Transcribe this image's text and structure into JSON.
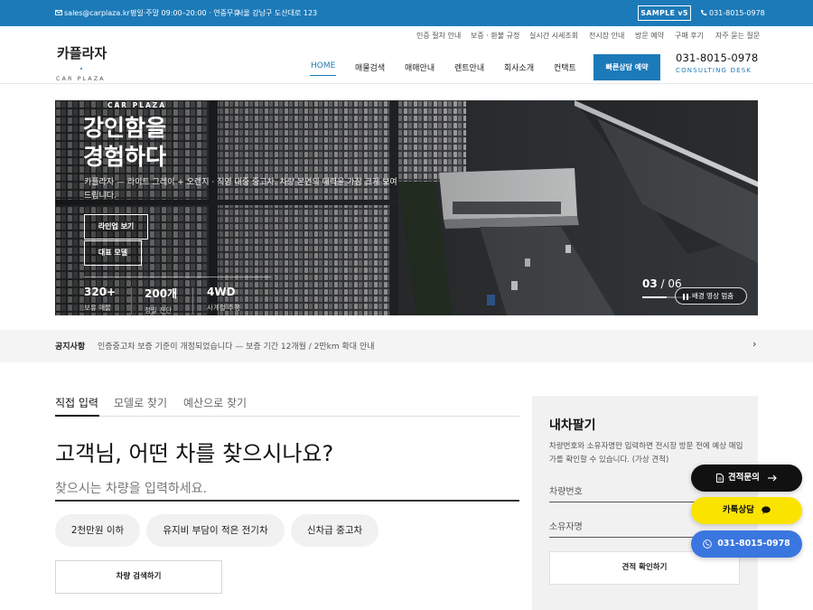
{
  "topbar": {
    "email": "sales@carplaza.kr",
    "hours": "평일·주말 09:00–20:00 · 연중무휴",
    "address": "서울 강남구 도산대로 123",
    "sample_badge": "SAMPLE v5",
    "phone": "031-8015-0978",
    "icons": [
      "mail-icon",
      "phone-icon"
    ]
  },
  "header": {
    "utility_links": [
      "인증 절차 안내",
      "보증 · 환불 규정",
      "실시간 시세조회",
      "전시장 안내",
      "방문 예약",
      "구매 후기",
      "자주 묻는 질문"
    ],
    "logo_name": "카플라자",
    "logo_sub": "CAR PLAZA",
    "nav": [
      "HOME",
      "매물검색",
      "매매안내",
      "렌트안내",
      "회사소개",
      "컨택트"
    ],
    "active_nav": "HOME",
    "cta_label": "빠른상담 예약",
    "phone": "031-8015-0978",
    "consult_label": "CONSULTING DESK"
  },
  "hero": {
    "brand": "CAR PLAZA",
    "title_line1": "강인함을",
    "title_line2": "경험하다",
    "description": "카플라자 — 라이트 그레이 + 오렌지 · 직영 대중 중고차. 차량 본연의 매력을 가장 크게 보여드립니다.",
    "buttons": [
      "라인업 보기",
      "대표 모델"
    ],
    "stats": [
      {
        "value": "320+",
        "label": "보유 매물"
      },
      {
        "value": "200개",
        "label": "정밀 진단"
      },
      {
        "value": "4WD",
        "label": "사계절 주행"
      }
    ],
    "slide_current": "03",
    "slide_sep": " / ",
    "slide_total": "06",
    "slide_progress": 0.5,
    "pause_label": "배경 영상 멈춤"
  },
  "notice": {
    "label": "공지사항",
    "text": "인증중고차 보증 기준이 개정되었습니다 — 보증 기간 12개월 / 2만km 확대 안내",
    "arrow": "›"
  },
  "search": {
    "tabs": [
      "직접 입력",
      "모델로 찾기",
      "예산으로 찾기"
    ],
    "active_tab": "직접 입력",
    "headline": "고객님, 어떤 차를 찾으시나요?",
    "input_placeholder": "찾으시는 차량을 입력하세요.",
    "chips": [
      "2천만원 이하",
      "유지비 부담이 적은 전기차",
      "신차급 중고차"
    ],
    "button_label": "차량 검색하기"
  },
  "sell": {
    "title": "내차팔기",
    "description": "차량번호와 소유자명만 입력하면 전시장 방문 전에 예상 매입가를 확인할 수 있습니다. (가상 견적)",
    "plate_placeholder": "차량번호",
    "owner_placeholder": "소유자명",
    "button_label": "견적 확인하기"
  },
  "floating": {
    "quote_label": "견적문의",
    "kakao_label": "카톡상담",
    "call_label": "031-8015-0978",
    "colors": {
      "quote": "#111111",
      "kakao": "#fbe300",
      "call": "#3a76df"
    }
  },
  "theme": {
    "accent": "#1d7ab8"
  }
}
